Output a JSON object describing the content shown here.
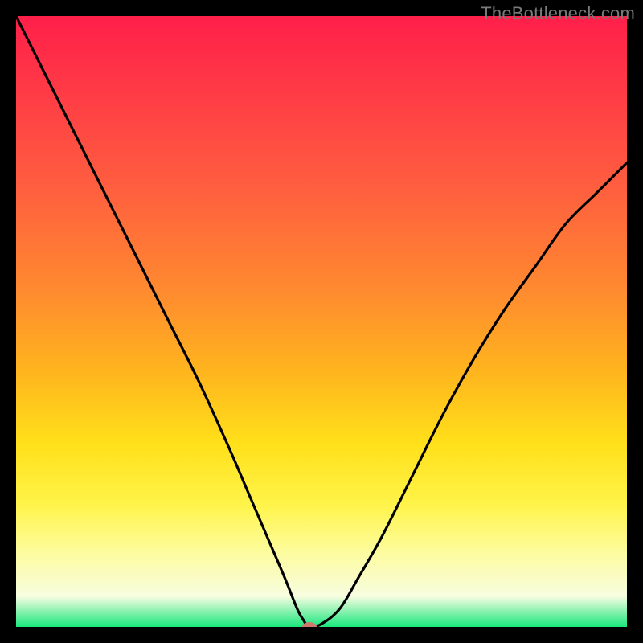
{
  "watermark": "TheBottleneck.com",
  "chart_data": {
    "type": "line",
    "title": "",
    "xlabel": "",
    "ylabel": "",
    "xlim": [
      0,
      100
    ],
    "ylim": [
      0,
      100
    ],
    "grid": false,
    "background_gradient": {
      "top": "#ff1f4a",
      "upper_mid": "#ff8a2f",
      "mid": "#ffe01a",
      "lower_mid": "#fdfca0",
      "bottom": "#18e77d"
    },
    "series": [
      {
        "name": "bottleneck-curve",
        "color": "#000000",
        "x": [
          0,
          5,
          10,
          15,
          20,
          25,
          30,
          35,
          38,
          41,
          44,
          46,
          47,
          48,
          50,
          53,
          56,
          60,
          65,
          70,
          75,
          80,
          85,
          90,
          95,
          100
        ],
        "y": [
          100,
          90,
          80,
          70,
          60,
          50,
          40,
          29,
          22,
          15,
          8,
          3,
          1.2,
          0,
          0.5,
          3,
          8,
          15,
          25,
          35,
          44,
          52,
          59,
          66,
          71,
          76
        ]
      }
    ],
    "marker": {
      "name": "optimum-point",
      "x": 48,
      "y": 0,
      "color": "#cd7a6d"
    }
  }
}
